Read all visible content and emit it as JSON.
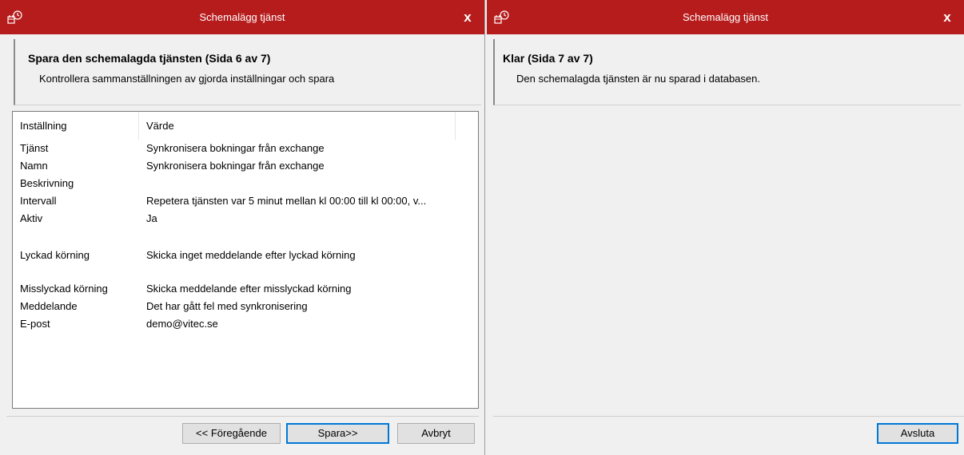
{
  "left_window": {
    "title": "Schemalägg tjänst",
    "close": "x",
    "header_title": "Spara den schemalagda tjänsten  (Sida 6 av 7)",
    "header_subtitle": "Kontrollera sammanställningen av gjorda inställningar och spara",
    "columns": [
      "Inställning",
      "Värde"
    ],
    "rows": [
      {
        "label": "Tjänst",
        "value": "Synkronisera bokningar från exchange"
      },
      {
        "label": "Namn",
        "value": "Synkronisera bokningar från exchange"
      },
      {
        "label": "Beskrivning",
        "value": ""
      },
      {
        "label": "Intervall",
        "value": "Repetera tjänsten var 5 minut mellan kl 00:00 till kl 00:00, v..."
      },
      {
        "label": "Aktiv",
        "value": "Ja"
      },
      {
        "label": "Lyckad körning",
        "value": "Skicka inget meddelande efter lyckad körning"
      },
      {
        "label": "Misslyckad körning",
        "value": "Skicka meddelande efter misslyckad körning"
      },
      {
        "label": "Meddelande",
        "value": "Det har gått fel med synkronisering"
      },
      {
        "label": "E-post",
        "value": "demo@vitec.se"
      }
    ],
    "buttons": {
      "previous": "<< Föregående",
      "save": "Spara>>",
      "cancel": "Avbryt"
    }
  },
  "right_window": {
    "title": "Schemalägg tjänst",
    "close": "x",
    "header_title": "Klar (Sida 7 av 7)",
    "header_subtitle": "Den schemalagda tjänsten är nu sparad i databasen.",
    "buttons": {
      "finish": "Avsluta"
    }
  },
  "colors": {
    "titlebar": "#b71c1c",
    "window_bg": "#f0f0f0",
    "default_button_border": "#0078d7"
  }
}
